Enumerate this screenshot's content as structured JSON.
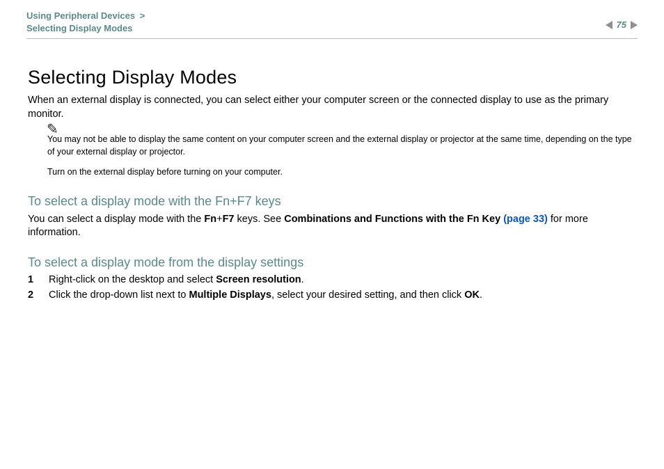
{
  "header": {
    "breadcrumb_line1": "Using Peripheral Devices",
    "breadcrumb_gt": ">",
    "breadcrumb_line2": "Selecting Display Modes",
    "page_number": "75"
  },
  "title": "Selecting Display Modes",
  "intro": "When an external display is connected, you can select either your computer screen or the connected display to use as the primary monitor.",
  "note": {
    "icon": "✎",
    "p1": "You may not be able to display the same content on your computer screen and the external display or projector at the same time, depending on the type of your external display or projector.",
    "p2": "Turn on the external display before turning on your computer."
  },
  "sectionA": {
    "heading": "To select a display mode with the Fn+F7 keys",
    "text_pre": "You can select a display mode with the ",
    "fn": "Fn",
    "plus": "+",
    "f7": "F7",
    "text_mid": " keys. See ",
    "ref_bold": "Combinations and Functions with the Fn Key ",
    "ref_link": "(page 33)",
    "text_post": " for more information."
  },
  "sectionB": {
    "heading": "To select a display mode from the display settings",
    "steps": [
      {
        "n": "1",
        "pre": "Right-click on the desktop and select ",
        "b": "Screen resolution",
        "post": "."
      },
      {
        "n": "2",
        "pre": "Click the drop-down list next to ",
        "b": "Multiple Displays",
        "mid": ", select your desired setting, and then click ",
        "b2": "OK",
        "post": "."
      }
    ]
  }
}
